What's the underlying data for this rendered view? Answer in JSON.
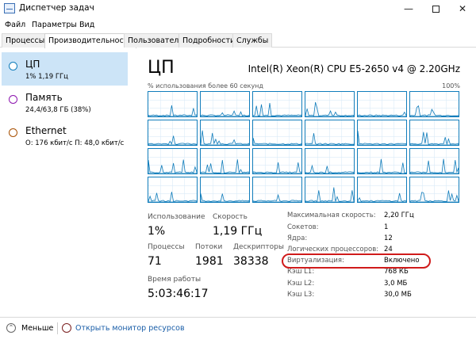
{
  "window": {
    "title": "Диспетчер задач",
    "min_glyph": "—",
    "close_glyph": "✕"
  },
  "menu": [
    "Файл",
    "Параметры",
    "Вид"
  ],
  "tabs": [
    "Процессы",
    "Производительность",
    "Пользователи",
    "Подробности",
    "Службы"
  ],
  "active_tab": "Производительность",
  "sidebar": [
    {
      "name": "ЦП",
      "sub": "1% 1,19 ГГц",
      "color": "#117dbb",
      "selected": true
    },
    {
      "name": "Память",
      "sub": "24,4/63,8 ГБ (38%)",
      "color": "#8b12ae",
      "selected": false
    },
    {
      "name": "Ethernet",
      "sub": "О: 176 кбит/с П: 48,0 кбит/с",
      "color": "#a74f01",
      "selected": false
    }
  ],
  "main": {
    "title": "ЦП",
    "model": "Intel(R) Xeon(R) CPU E5-2650 v4 @ 2.20GHz",
    "graph_label": "% использования более 60 секунд",
    "graph_max": "100%",
    "accent": "#117dbb"
  },
  "stats": {
    "usage_label": "Использование",
    "usage_value": "1%",
    "speed_label": "Скорость",
    "speed_value": "1,19 ГГц",
    "processes_label": "Процессы",
    "processes_value": "71",
    "threads_label": "Потоки",
    "threads_value": "1981",
    "handles_label": "Дескрипторы",
    "handles_value": "38338",
    "uptime_label": "Время работы",
    "uptime_value": "5:03:46:17"
  },
  "specs": [
    {
      "label": "Максимальная скорость:",
      "value": "2,20 ГГц"
    },
    {
      "label": "Сокетов:",
      "value": "1"
    },
    {
      "label": "Ядра:",
      "value": "12"
    },
    {
      "label": "Логических процессоров:",
      "value": "24"
    },
    {
      "label": "Виртуализация:",
      "value": "Включено"
    },
    {
      "label": "Кэш L1:",
      "value": "768 КБ"
    },
    {
      "label": "Кэш L2:",
      "value": "3,0 МБ"
    },
    {
      "label": "Кэш L3:",
      "value": "30,0 МБ"
    }
  ],
  "footer": {
    "less_label": "Меньше",
    "monitor_link": "Открыть монитор ресурсов"
  }
}
